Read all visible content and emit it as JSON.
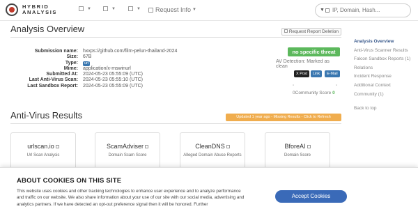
{
  "header": {
    "logo_line1": "HYBRID",
    "logo_line2": "ANALYSIS",
    "nav_request_info": "Request Info",
    "search_placeholder": "IP, Domain, Hash..."
  },
  "overview": {
    "title": "Analysis Overview",
    "delete_button": "Request Report Deletion",
    "fields": [
      {
        "label": "Submission name:",
        "value": "hxxps://github.com/film-pelun-thailand-2024"
      },
      {
        "label": "Size:",
        "value": "67B"
      },
      {
        "label": "Type:",
        "value": "url"
      },
      {
        "label": "Mime:",
        "value": "application/x-mswinurl"
      },
      {
        "label": "Submitted At:",
        "value": "2024-05-23 05:55:09 (UTC)"
      },
      {
        "label": "Last Anti-Virus Scan:",
        "value": "2024-05-23 05:55:10 (UTC)"
      },
      {
        "label": "Last Sandbox Report:",
        "value": "2024-05-23 05:55:09 (UTC)"
      }
    ],
    "verdict": "no specific threat",
    "av_detection": "AV Detection: Marked as clean",
    "share_x": "X Post",
    "share_link": "Link",
    "share_email": "E-Mail",
    "community_score_value": "0",
    "community_score_label": "Community Score",
    "community_score_count": "0",
    "colors": {
      "verdict": "#5cb85c",
      "accent": "#3a77b0",
      "warning": "#f0ad4e"
    }
  },
  "antivirus": {
    "title": "Anti-Virus Results",
    "updated_badge": "Updated 1 year ago - Missing Results - Click to Refresh",
    "cards": [
      {
        "name": "urlscan.io",
        "desc": "Url Scan Analysis"
      },
      {
        "name": "ScamAdviser",
        "desc": "Domain Scam Score"
      },
      {
        "name": "CleanDNS",
        "desc": "Alleged Domain Abuse Reports"
      },
      {
        "name": "BforeAI",
        "desc": "Domain Score"
      }
    ]
  },
  "sidebar": {
    "items": [
      "Analysis Overview",
      "Anti-Virus Scanner Results",
      "Falcon Sandbox Reports (1)",
      "Relations",
      "Incident Response",
      "Additional Context",
      "Community (1)"
    ],
    "back_to_top": "Back to top"
  },
  "cookie": {
    "title": "ABOUT COOKIES ON THIS SITE",
    "text": "This website uses cookies and other tracking technologies to enhance user experience and to analyze performance and traffic on our website. We also share information about your use of our site with our social media, advertising and analytics partners. If we have detected an opt-out preference signal then it will be honored. Further",
    "accept": "Accept Cookies"
  }
}
